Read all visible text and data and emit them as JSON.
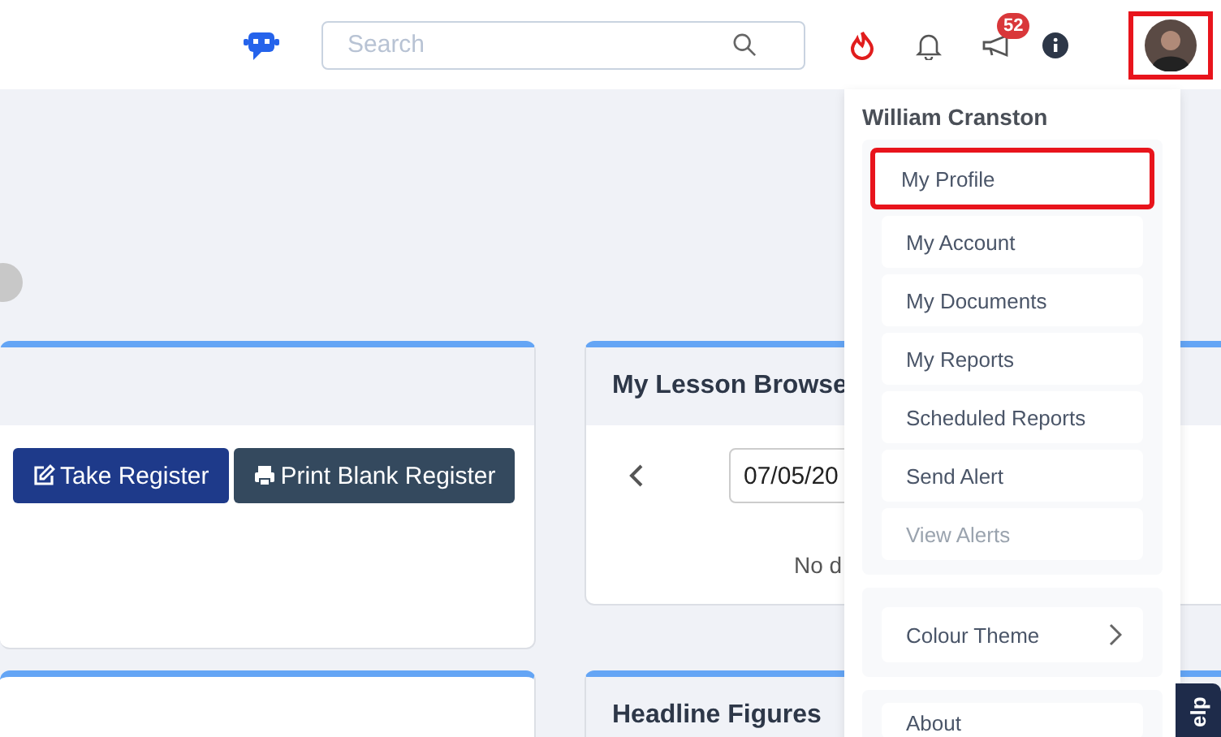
{
  "top_bar": {
    "search": {
      "placeholder": "Search"
    },
    "notification_count": "52",
    "avatar": {
      "highlighted": true
    }
  },
  "register_card": {
    "buttons": [
      {
        "label": "Take Register",
        "kind": "primary"
      },
      {
        "label": "Print Blank Register",
        "kind": "secondary"
      }
    ]
  },
  "lesson_browser": {
    "title": "My Lesson Browse",
    "date": "07/05/20",
    "message": "No d"
  },
  "headline_card": {
    "title": "Headline Figures"
  },
  "user_menu": {
    "user_name": "William Cranston",
    "items": [
      {
        "label": "My Profile",
        "disabled": false,
        "highlighted": true
      },
      {
        "label": "My Account",
        "disabled": false,
        "highlighted": false
      },
      {
        "label": "My Documents",
        "disabled": false,
        "highlighted": false
      },
      {
        "label": "My Reports",
        "disabled": false,
        "highlighted": false
      },
      {
        "label": "Scheduled Reports",
        "disabled": false,
        "highlighted": false
      },
      {
        "label": "Send Alert",
        "disabled": false,
        "highlighted": false
      },
      {
        "label": "View Alerts",
        "disabled": true,
        "highlighted": false
      }
    ],
    "theme_item": {
      "label": "Colour Theme"
    },
    "about_item": {
      "label": "About"
    }
  },
  "help_tab": {
    "label": "elp"
  }
}
